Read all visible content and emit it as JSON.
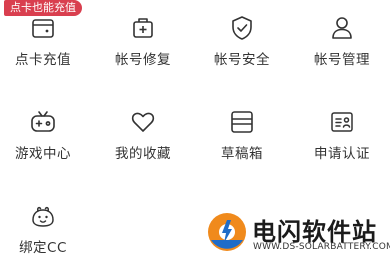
{
  "promo_badge": "点卡也能充值",
  "menu": [
    {
      "label": "点卡充值",
      "icon": "card-wallet-icon"
    },
    {
      "label": "帐号修复",
      "icon": "medkit-icon"
    },
    {
      "label": "帐号安全",
      "icon": "shield-check-icon"
    },
    {
      "label": "帐号管理",
      "icon": "user-icon"
    },
    {
      "label": "游戏中心",
      "icon": "gamepad-icon"
    },
    {
      "label": "我的收藏",
      "icon": "heart-icon"
    },
    {
      "label": "草稿箱",
      "icon": "drafts-box-icon"
    },
    {
      "label": "申请认证",
      "icon": "id-card-icon"
    },
    {
      "label": "绑定CC",
      "icon": "cc-pet-icon"
    }
  ],
  "watermark": {
    "title": "电闪软件站",
    "url": "WWW.DS-SOLARBATTERY.COM"
  }
}
